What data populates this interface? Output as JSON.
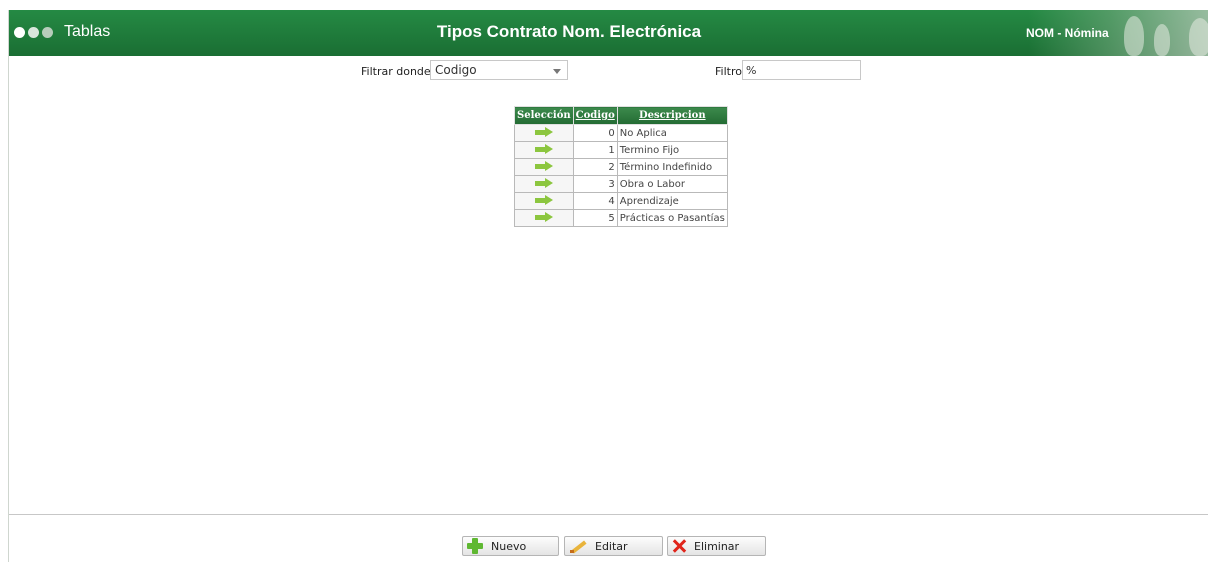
{
  "header": {
    "app_title": "Tablas",
    "page_title": "Tipos Contrato Nom. Electrónica",
    "module": "NOM - Nómina"
  },
  "filters": {
    "filtrar_label": "Filtrar donde",
    "field_selected": "Codigo",
    "filtro_label": "Filtro",
    "filtro_value": "%"
  },
  "table": {
    "columns": [
      "Selección",
      "Codigo",
      "Descripcion"
    ],
    "rows": [
      {
        "codigo": "0",
        "descripcion": "No Aplica"
      },
      {
        "codigo": "1",
        "descripcion": "Termino Fijo"
      },
      {
        "codigo": "2",
        "descripcion": "Término Indefinido"
      },
      {
        "codigo": "3",
        "descripcion": "Obra o Labor"
      },
      {
        "codigo": "4",
        "descripcion": "Aprendizaje"
      },
      {
        "codigo": "5",
        "descripcion": "Prácticas o Pasantías"
      }
    ]
  },
  "actions": {
    "nuevo": "Nuevo",
    "editar": "Editar",
    "eliminar": "Eliminar"
  },
  "colors": {
    "header_green": "#1e7a3a",
    "arrow_green": "#8cc63f",
    "delete_red": "#e0251b"
  },
  "icons": [
    "status-dots-icon",
    "arrow-right-icon",
    "plus-icon",
    "pencil-icon",
    "x-icon",
    "chevron-down-icon"
  ]
}
